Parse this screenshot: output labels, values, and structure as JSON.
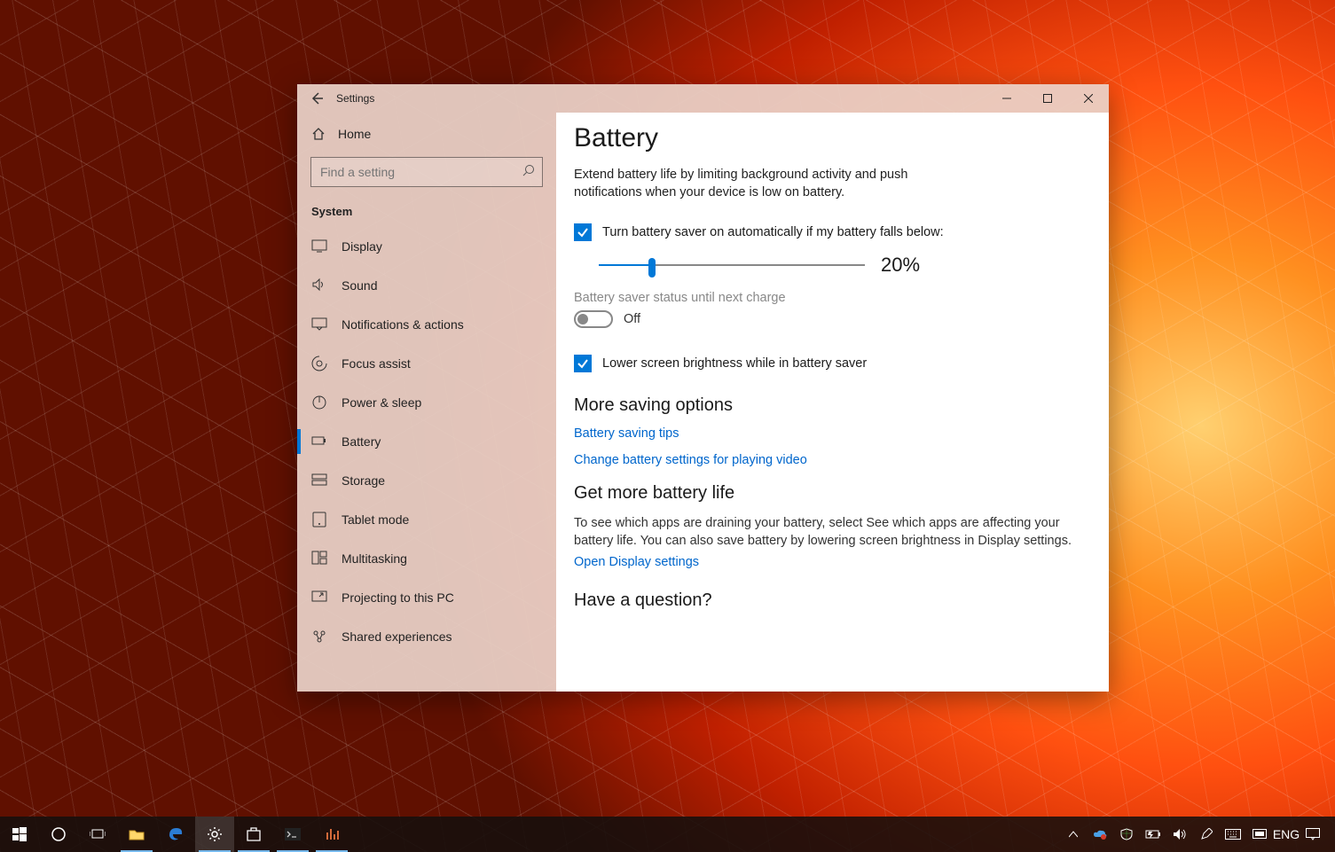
{
  "window": {
    "title": "Settings",
    "home_label": "Home",
    "search_placeholder": "Find a setting",
    "category": "System"
  },
  "nav": [
    {
      "icon": "display",
      "label": "Display"
    },
    {
      "icon": "sound",
      "label": "Sound"
    },
    {
      "icon": "notifications",
      "label": "Notifications & actions"
    },
    {
      "icon": "focus",
      "label": "Focus assist"
    },
    {
      "icon": "power",
      "label": "Power & sleep"
    },
    {
      "icon": "battery",
      "label": "Battery",
      "active": true
    },
    {
      "icon": "storage",
      "label": "Storage"
    },
    {
      "icon": "tablet",
      "label": "Tablet mode"
    },
    {
      "icon": "multitasking",
      "label": "Multitasking"
    },
    {
      "icon": "projecting",
      "label": "Projecting to this PC"
    },
    {
      "icon": "shared",
      "label": "Shared experiences"
    }
  ],
  "page": {
    "title": "Battery",
    "description": "Extend battery life by limiting background activity and push notifications when your device is low on battery.",
    "auto_checkbox_label": "Turn battery saver on automatically if my battery falls below:",
    "slider_value_text": "20%",
    "slider_value": 20,
    "status_label": "Battery saver status until next charge",
    "toggle_state": "Off",
    "brightness_checkbox_label": "Lower screen brightness while in battery saver",
    "more_saving_title": "More saving options",
    "link_tips": "Battery saving tips",
    "link_video": "Change battery settings for playing video",
    "get_more_title": "Get more battery life",
    "get_more_text": "To see which apps are draining your battery, select See which apps are affecting your battery life. You can also save battery by lowering screen brightness in Display settings.",
    "link_display": "Open Display settings",
    "question_title": "Have a question?"
  },
  "tray": {
    "language": "ENG"
  }
}
